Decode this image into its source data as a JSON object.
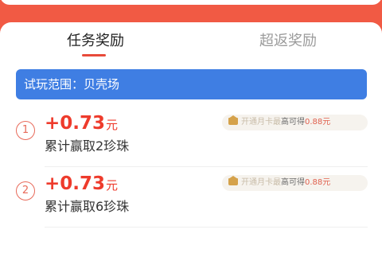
{
  "tabs": [
    {
      "label": "任务奖励",
      "active": true
    },
    {
      "label": "超返奖励",
      "active": false
    }
  ],
  "scope": {
    "text": "试玩范围：贝壳场"
  },
  "tasks": [
    {
      "index": "1",
      "reward_amount": "+0.73",
      "reward_unit": "元",
      "description": "累计赢取2珍珠",
      "bonus": {
        "prefix": "开通月卡最",
        "middle": "高可得",
        "amount": "0.88元",
        "icon": "crown-icon"
      }
    },
    {
      "index": "2",
      "reward_amount": "+0.73",
      "reward_unit": "元",
      "description": "累计赢取6珍珠",
      "bonus": {
        "prefix": "开通月卡最",
        "middle": "高可得",
        "amount": "0.88元",
        "icon": "crown-icon"
      }
    }
  ],
  "colors": {
    "background": "#f15a44",
    "accent_red": "#ee3b2c",
    "scope_blue": "#3f7ee3"
  }
}
